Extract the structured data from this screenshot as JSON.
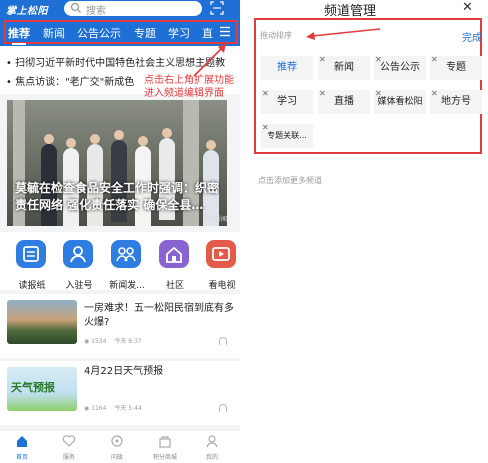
{
  "left": {
    "logo": "掌上松阳",
    "search_placeholder": "搜索",
    "tabs": [
      "推荐",
      "新闻",
      "公告公示",
      "专题",
      "学习",
      "直"
    ],
    "ticker": [
      "• 扫彻习近平新时代中国特色社会主义思想主题教",
      "• 焦点访谈：\"老广交\"新成色"
    ],
    "annotation": [
      "点击右上角扩展功能",
      "进入频道编辑界面"
    ],
    "hero": {
      "title": "莫毓在检查食品安全工作时强调：织密责任网络 强化责任落实 确保全县…",
      "brand": "松阳新闻"
    },
    "shortcuts": [
      {
        "label": "读报纸",
        "icon": "newspaper-icon",
        "color": "#2f7de1"
      },
      {
        "label": "入驻号",
        "icon": "account-icon",
        "color": "#2f7de1"
      },
      {
        "label": "新闻发...",
        "icon": "press-conference-icon",
        "color": "#2f7de1"
      },
      {
        "label": "社区",
        "icon": "community-icon",
        "color": "#8a63d2"
      },
      {
        "label": "看电视",
        "icon": "tv-icon",
        "color": "#e25b4b"
      }
    ],
    "news": [
      {
        "title": "一房难求！五一松阳民宿到底有多火爆?",
        "views": "1534",
        "time": "今天 8:37",
        "thumb_text": ""
      },
      {
        "title": "4月22日天气预报",
        "views": "1164",
        "time": "今天 5:44",
        "thumb_text": "天气预报"
      }
    ],
    "bottom_nav": [
      {
        "label": "首页",
        "icon": "home-icon",
        "active": true
      },
      {
        "label": "服务",
        "icon": "service-icon",
        "active": false
      },
      {
        "label": "问政",
        "icon": "inquiry-icon",
        "active": false
      },
      {
        "label": "积分商城",
        "icon": "mall-icon",
        "active": false
      },
      {
        "label": "我的",
        "icon": "profile-icon",
        "active": false
      }
    ]
  },
  "right": {
    "title": "频道管理",
    "close": "✕",
    "drag_hint": "拖动排序",
    "done": "完成",
    "channels": [
      {
        "label": "推荐",
        "fixed": true,
        "removable": false
      },
      {
        "label": "新闻",
        "fixed": false,
        "removable": true
      },
      {
        "label": "公告公示",
        "fixed": false,
        "removable": true
      },
      {
        "label": "专题",
        "fixed": false,
        "removable": true
      },
      {
        "label": "学习",
        "fixed": false,
        "removable": true
      },
      {
        "label": "直播",
        "fixed": false,
        "removable": true
      },
      {
        "label": "媒体看松阳",
        "fixed": false,
        "removable": true
      },
      {
        "label": "地方号",
        "fixed": false,
        "removable": true
      },
      {
        "label": "专题关联...",
        "fixed": false,
        "removable": true
      }
    ],
    "more_hint": "点击添加更多频道"
  },
  "colors": {
    "brand_blue": "#1e6fd6",
    "annotation_red": "#e23b3b"
  }
}
